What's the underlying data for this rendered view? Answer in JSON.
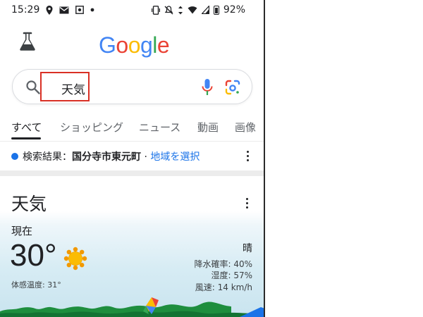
{
  "status_bar": {
    "time": "15:29",
    "battery": "92%",
    "left_icons": [
      "location-icon",
      "mail-icon",
      "app-icon",
      "dot-icon"
    ],
    "right_icons": [
      "vibrate-icon",
      "mute-icon",
      "data-arrows-icon",
      "wifi-icon",
      "signal-icon",
      "battery-icon"
    ]
  },
  "header": {
    "labs_icon": "flask-icon",
    "logo_text": "Google",
    "logo_colors": [
      "#4285F4",
      "#EA4335",
      "#FBBC05",
      "#4285F4",
      "#34A853",
      "#EA4335"
    ]
  },
  "search": {
    "query": "天気",
    "highlight_color": "#d93025",
    "icons": [
      "search-icon",
      "mic-icon",
      "lens-icon"
    ]
  },
  "tabs": [
    {
      "label": "すべて",
      "active": true
    },
    {
      "label": "ショッピング",
      "active": false
    },
    {
      "label": "ニュース",
      "active": false
    },
    {
      "label": "動画",
      "active": false
    },
    {
      "label": "画像",
      "active": false
    }
  ],
  "location": {
    "prefix": "検索結果：",
    "place": "国分寺市東元町",
    "separator": " · ",
    "link": "地域を選択"
  },
  "weather": {
    "title": "天気",
    "now_label": "現在",
    "temperature": "30°",
    "feels_like": "体感温度: 31°",
    "condition": "晴",
    "precipitation": "降水確率: 40%",
    "humidity": "湿度: 57%",
    "wind": "風速: 14 km/h",
    "condition_icon": "sun-icon"
  },
  "colors": {
    "accent_blue": "#1a73e8",
    "text": "#202124",
    "muted": "#5f6368"
  }
}
